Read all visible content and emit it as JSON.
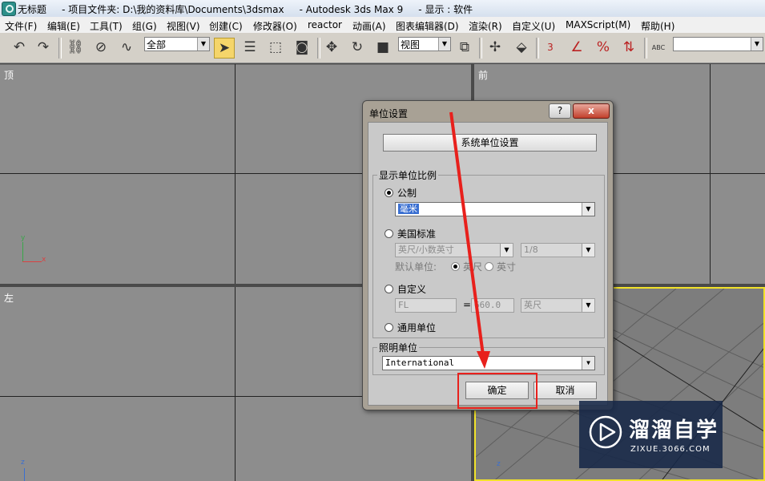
{
  "window": {
    "title": "无标题     - 项目文件夹: D:\\我的资料库\\Documents\\3dsmax     - Autodesk 3ds Max 9     - 显示 : 软件"
  },
  "menu": [
    "文件(F)",
    "编辑(E)",
    "工具(T)",
    "组(G)",
    "视图(V)",
    "创建(C)",
    "修改器(O)",
    "reactor",
    "动画(A)",
    "图表编辑器(D)",
    "渲染(R)",
    "自定义(U)",
    "MAXScript(M)",
    "帮助(H)"
  ],
  "toolbar": {
    "selection_filter": "全部",
    "ref_coord": "视图",
    "icons": [
      "undo-icon",
      "redo-icon",
      "link-icon",
      "unlink-icon",
      "bind-space-warp-icon",
      "select-object-icon",
      "select-by-name-icon",
      "rect-selection-icon",
      "window-crossing-icon",
      "move-icon",
      "rotate-icon",
      "scale-icon",
      "pivot-icon",
      "manipulate-icon",
      "keyboard-shortcut-icon",
      "snap-3-icon",
      "angle-snap-icon",
      "percent-snap-icon",
      "spinner-snap-icon",
      "named-selection-icon"
    ],
    "snap_label": "3",
    "percent_label": "%",
    "named_sel_label": "ABC"
  },
  "viewports": {
    "top": "顶",
    "front": "前",
    "left": "左",
    "axis_x": "x",
    "axis_y": "y",
    "axis_z": "z"
  },
  "dialog": {
    "title": "单位设置",
    "help_label": "?",
    "close_label": "x",
    "system_unit_button": "系统单位设置",
    "display_group_label": "显示单位比例",
    "metric_label": "公制",
    "metric_value": "毫米",
    "us_label": "美国标准",
    "us_value": "英尺/小数英寸",
    "fraction_value": "1/8",
    "default_unit_label": "默认单位:",
    "feet_label": "英尺",
    "inch_label": "英寸",
    "custom_label": "自定义",
    "custom_name": "FL",
    "equals": "=",
    "custom_value": "660.0",
    "custom_unit": "英尺",
    "generic_label": "通用单位",
    "lighting_group_label": "照明单位",
    "lighting_value": "International",
    "ok_label": "确定",
    "cancel_label": "取消",
    "selected_scale": "metric"
  },
  "watermark": {
    "brand": "溜溜自学",
    "url": "ZIXUE.3066.COM"
  },
  "colors": {
    "annotation_red": "#e8201c",
    "active_viewport": "#f2e22a",
    "watermark_bg": "#172848"
  }
}
